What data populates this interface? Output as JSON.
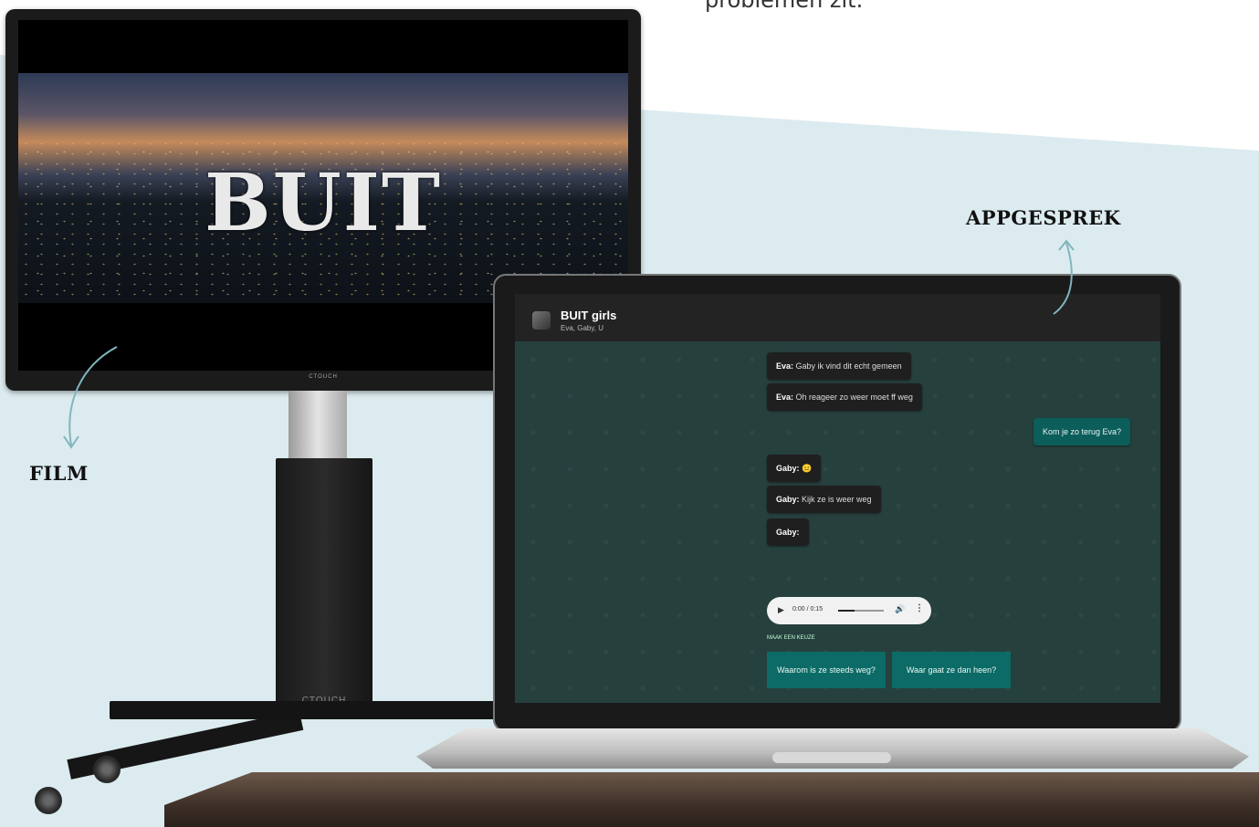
{
  "top_text": "problemen zit.",
  "annotations": {
    "film": "FILM",
    "appgesprek": "APPGESPREK"
  },
  "tv": {
    "title": "BUIT",
    "brand": "CTOUCH",
    "stand_brand": "CTOUCH"
  },
  "chat": {
    "name": "BUIT girls",
    "members": "Eva, Gaby, U",
    "messages": [
      {
        "sender": "Eva:",
        "text": " Gaby ik vind dit echt gemeen"
      },
      {
        "sender": "Eva:",
        "text": " Oh reageer zo weer moet ff weg"
      },
      {
        "sender": "",
        "text": "Kom je zo terug Eva?"
      },
      {
        "sender": "Gaby:",
        "text": " 😐"
      },
      {
        "sender": "Gaby:",
        "text": " Kijk ze is weer weg"
      },
      {
        "sender": "Gaby:",
        "text": ""
      }
    ],
    "audio": {
      "play": "▶",
      "time": "0:00 / 0:15",
      "volume": "🔊",
      "more": "⋮"
    },
    "choice_label": "MAAK EEN KEUZE",
    "choices": [
      "Waarom is ze steeds weg?",
      "Waar gaat ze dan heen?"
    ]
  },
  "colors": {
    "background_band": "#dcebef",
    "chat_outgoing": "#0c5e5a",
    "choice_button": "#0c6b66",
    "arrow": "#7fb6be"
  }
}
